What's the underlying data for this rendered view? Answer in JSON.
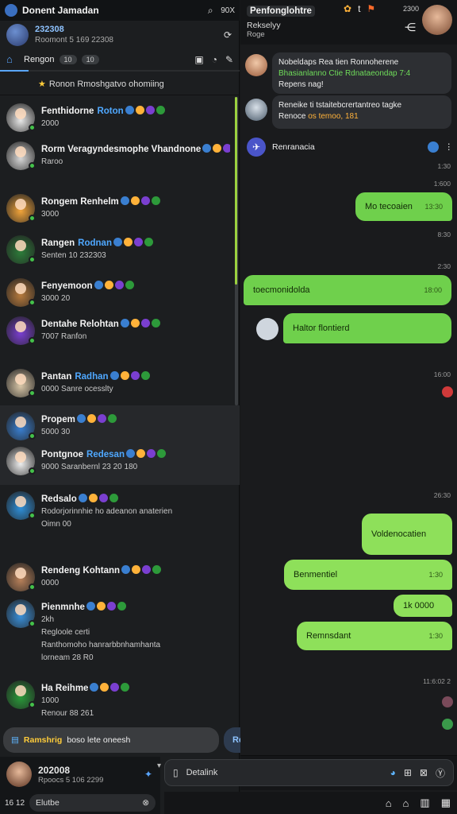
{
  "left": {
    "app_title": "Donent Jamadan",
    "search_icon": "search-icon",
    "top_right": "90X",
    "account": {
      "line1": "232308",
      "line2": "Roomont 5 169 22308"
    },
    "tabs": {
      "label": "Rengon",
      "pill1": "10",
      "pill2": "10"
    },
    "pinned": "Ronon   Rmoshgatvo ohomiing",
    "chats": [
      {
        "name": "Fenthidorne",
        "tag": "Roton",
        "sub": "2000",
        "color": "#e8e8e8"
      },
      {
        "name": "Rorm Veragyndesmophe Vhandnone",
        "tag": "",
        "sub": "Raroo",
        "color": "#d7d7d7"
      },
      {
        "name": "Rongem Renhelm",
        "tag": "",
        "sub": "3000",
        "color": "#f2a43a"
      },
      {
        "name": "Rangen",
        "tag": "Rodnan",
        "sub": "Senten 10 232303",
        "color": "#2d7d3a"
      },
      {
        "name": "Fenyemoon",
        "tag": "",
        "sub": "3000 20",
        "color": "#b77a3d"
      },
      {
        "name": "Dentahe Relohtan",
        "tag": "",
        "sub": "7007 Ranfon",
        "color": "#7a3fd0"
      },
      {
        "name": "Pantan",
        "tag": "Radhan",
        "sub": "0000 Sanre ocesslty",
        "color": "#d9c7a8"
      },
      {
        "name": "Propem",
        "tag": "",
        "sub": "5000 30",
        "color": "#3a7fd0"
      },
      {
        "name": "Pontgnoe",
        "tag": "Redesan",
        "sub": "9000 Saranbernl 23 20 180",
        "color": "#eee"
      },
      {
        "name": "Redsalo",
        "tag": "",
        "sub": "Rodorjorinnhie ho adeanon anaterien",
        "sub2": "Oimn 00",
        "color": "#2f8fd8"
      },
      {
        "name": "Rendeng Kohtann",
        "tag": "",
        "sub": "0000",
        "color": "#b8815a"
      },
      {
        "name": "Pienmnhe",
        "tag": "",
        "sub": "2kh",
        "sub2": "Regloole certi",
        "sub3": "Ranthomoho hanrarbbnhamhanta",
        "sub4": "lorneam 28 R0",
        "color": "#3a8fd8"
      },
      {
        "name": "Ha Reihme",
        "tag": "",
        "sub": "1000",
        "sub2": "Renour 88 261",
        "color": "#2a9a3a"
      }
    ],
    "compose": {
      "highlight": "Ramshrig",
      "text": "boso lete oneesh",
      "send": "Reset"
    },
    "me": {
      "name": "202008",
      "line2": "Rpoocs 5 106 2299"
    },
    "search": {
      "label": "Elutbe",
      "counter": "16 12"
    }
  },
  "right": {
    "title": "Penfonglohtre",
    "subtitle": "Rekselyy",
    "subline": "Roge",
    "time": "2300",
    "bot_name": "Renranacia",
    "group1": {
      "line1": "Nobeldaps Rea tien Ronnoherene",
      "line2": "Bhasianlanno Ctie Rdnataeondap 7:4",
      "line3": "Repens nag!"
    },
    "group2": {
      "line1": "Reneike ti tstaitebcrertantreo tagke",
      "line2": "Renoce",
      "line3": "os temoo, 181"
    },
    "messages": [
      {
        "dir": "out",
        "text": "Mo  tecoaien",
        "time": "13:30"
      },
      {
        "dir": "in",
        "text": "toecmonidolda",
        "time": "18:00"
      },
      {
        "dir": "in",
        "text": "Haltor flontierd",
        "time": ""
      },
      {
        "dir": "out",
        "text": "Voldenocatien",
        "time": "16:00"
      },
      {
        "dir": "out",
        "text": "Benmentiel",
        "time": "1:30"
      },
      {
        "dir": "out",
        "text": "1k 0000",
        "time": ""
      },
      {
        "dir": "out",
        "text": "Remnsdant",
        "time": "1:30"
      }
    ],
    "timestamps": [
      "1:30",
      "1:600",
      "8:30",
      "2:30",
      "16:00",
      "26:30",
      "1:50",
      "11:6:02 2"
    ],
    "input_placeholder": "Detalink"
  }
}
